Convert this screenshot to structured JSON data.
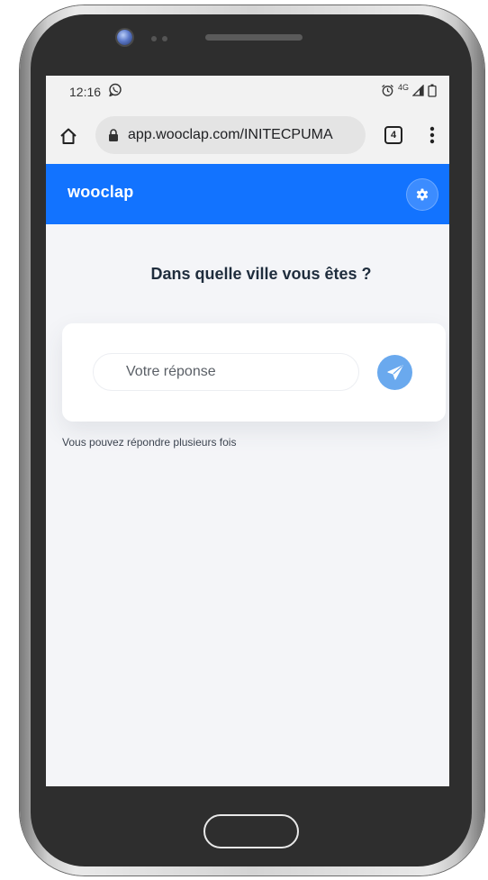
{
  "status_bar": {
    "time": "12:16",
    "network": "4G"
  },
  "browser": {
    "url": "app.wooclap.com/INITECPUMA",
    "tab_count": "4"
  },
  "app": {
    "logo": "wooclap",
    "brand_color": "#1273ff"
  },
  "question": {
    "title": "Dans quelle ville vous êtes ?"
  },
  "answer": {
    "placeholder": "Votre réponse",
    "value": ""
  },
  "hint": "Vous pouvez répondre plusieurs fois",
  "icons": [
    "whatsapp-icon",
    "alarm-icon",
    "signal-icon",
    "battery-icon",
    "home-icon",
    "lock-icon",
    "tabs-icon",
    "menu-icon",
    "gear-icon",
    "send-icon"
  ]
}
